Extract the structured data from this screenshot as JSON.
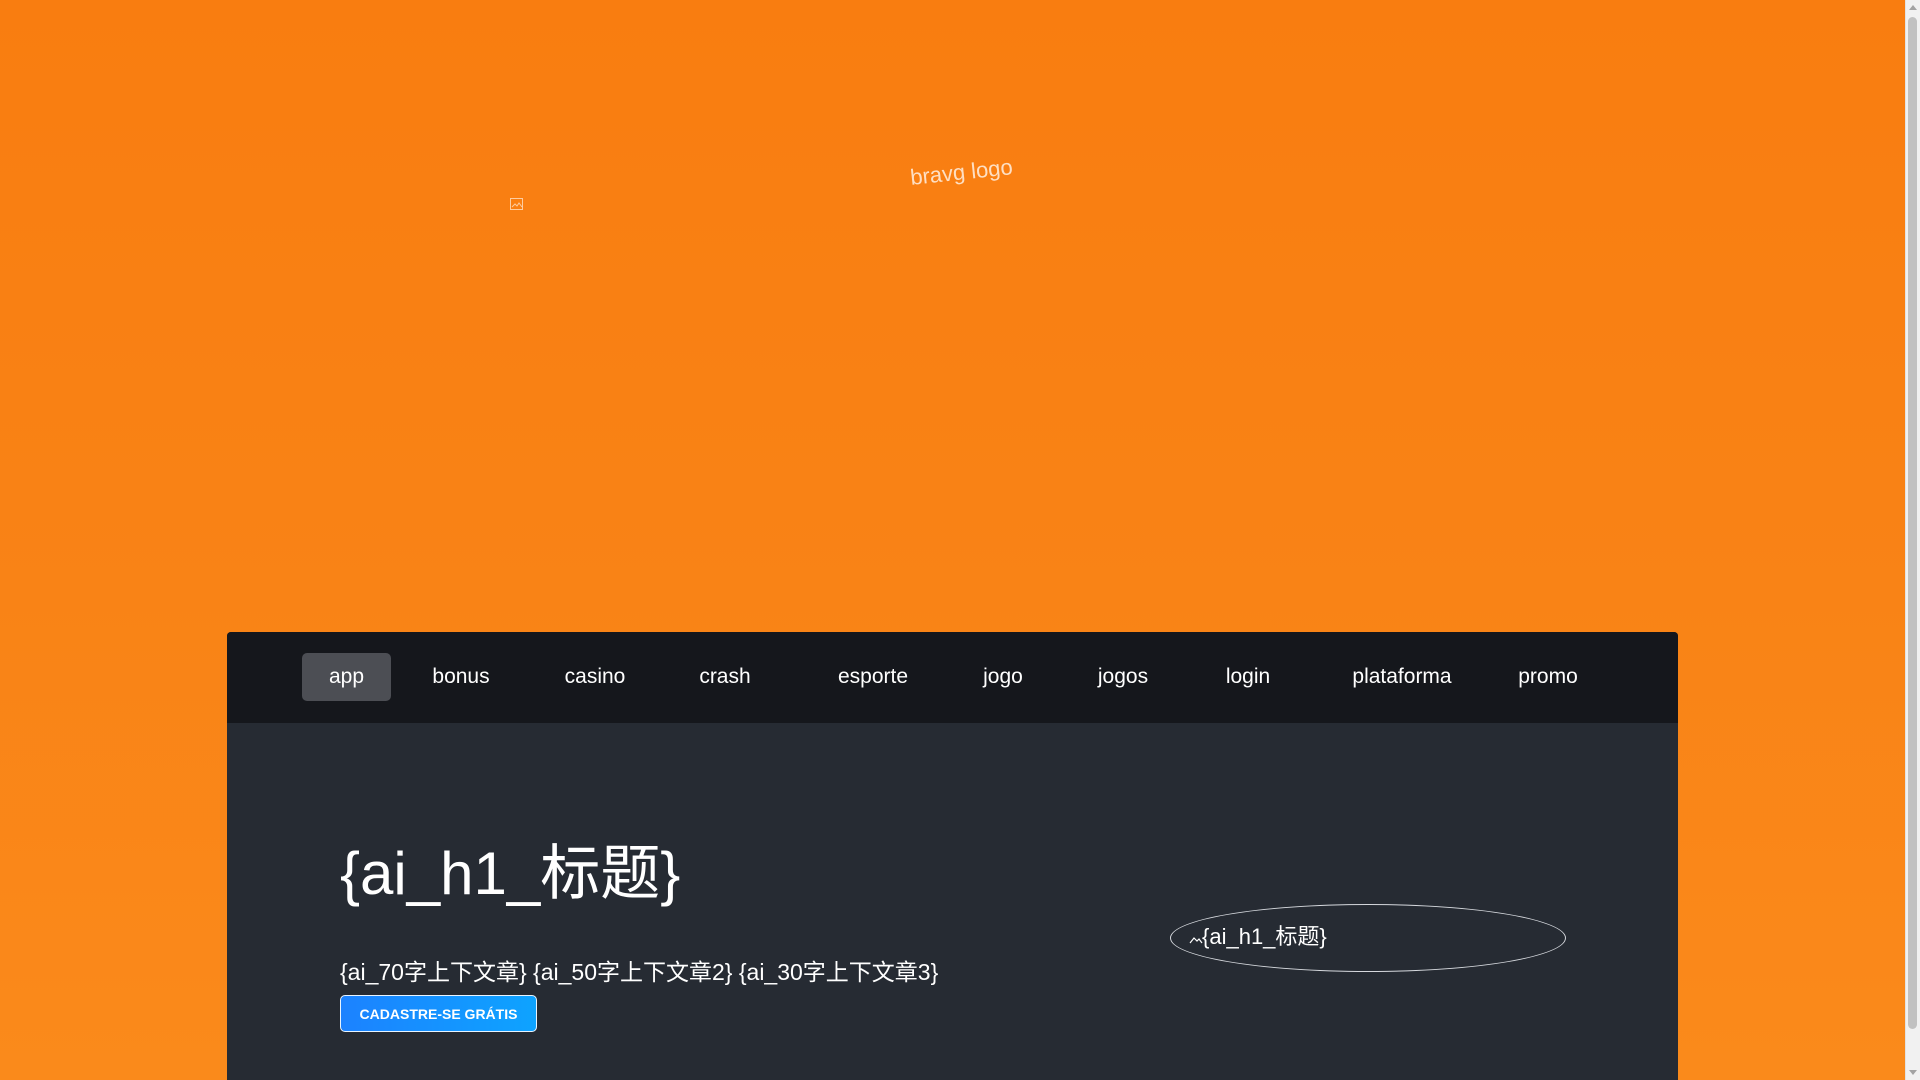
{
  "header": {
    "logo_alt": "bravg logo",
    "broken_image_icon": "broken-image-icon"
  },
  "nav": {
    "items": [
      {
        "label": "app",
        "active": true
      },
      {
        "label": "bonus",
        "active": false
      },
      {
        "label": "casino",
        "active": false
      },
      {
        "label": "crash",
        "active": false
      },
      {
        "label": "esporte",
        "active": false
      },
      {
        "label": "jogo",
        "active": false
      },
      {
        "label": "jogos",
        "active": false
      },
      {
        "label": "login",
        "active": false
      },
      {
        "label": "plataforma",
        "active": false
      },
      {
        "label": "promo",
        "active": false
      }
    ]
  },
  "hero": {
    "title": "{ai_h1_标题}",
    "description": "{ai_70字上下文章} {ai_50字上下文章2} {ai_30字上下文章3}",
    "cta_label": "CADASTRE-SE GRÁTIS",
    "image_alt": "{ai_h1_标题}",
    "image_icon": "broken-image-icon"
  },
  "colors": {
    "background": "#f98316",
    "card": "#262b33",
    "nav": "#15171c",
    "nav_active": "#4c4e54",
    "cta": "#1c82ff"
  }
}
